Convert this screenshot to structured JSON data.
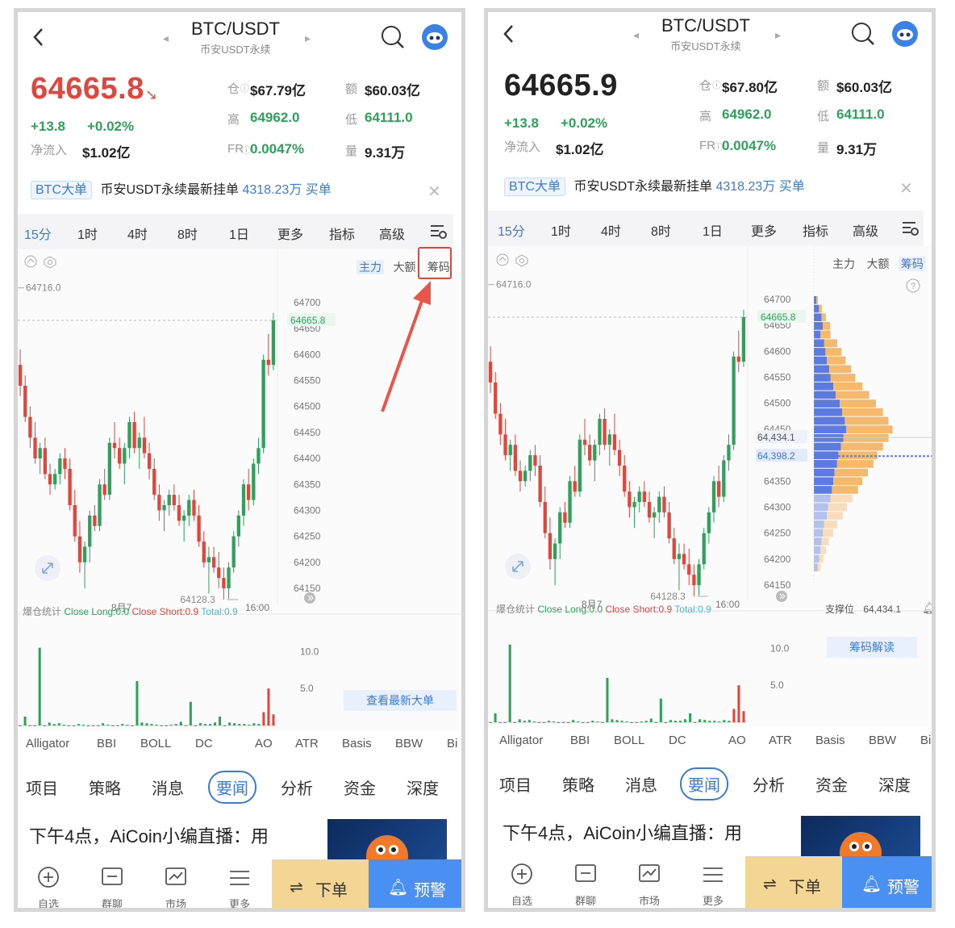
{
  "header": {
    "pair": "BTC/USDT",
    "subtitle": "币安USDT永续",
    "icons": [
      "back-arrow-icon",
      "prev-icon",
      "next-icon",
      "search-icon",
      "robot-avatar-icon"
    ]
  },
  "price_panel": {
    "left_price": "64665.8",
    "right_price": "64665.9",
    "change": "+13.8",
    "change_pct": "+0.02%",
    "net_inflow_label": "净流入",
    "net_inflow": "$1.02亿",
    "oi_label": "仓",
    "left_oi": "$67.79亿",
    "right_oi": "$67.80亿",
    "vol_label": "额",
    "vol": "$60.03亿",
    "high_label": "高",
    "high": "64962.0",
    "low_label": "低",
    "low": "64111.0",
    "fr_label": "FR",
    "fr": "0.0047%",
    "amount_label": "量",
    "amount": "9.31万"
  },
  "banner": {
    "tag": "BTC大单",
    "text": "币安USDT永续最新挂单",
    "amount": "4318.23万",
    "side": "买单"
  },
  "timeframes": {
    "items": [
      "15分",
      "1时",
      "4时",
      "8时",
      "1日",
      "更多",
      "指标",
      "高级"
    ],
    "active": "15分"
  },
  "chart": {
    "mode_buttons": [
      "主力",
      "大额",
      "筹码"
    ],
    "max_label": "64716.0",
    "min_label": "64128.3",
    "last_label": "64665.8",
    "y_ticks": [
      "64700",
      "64650",
      "64600",
      "64550",
      "64500",
      "64450",
      "64400",
      "64350",
      "64300",
      "64250",
      "64200",
      "64150"
    ],
    "x_ticks": [
      "8月7",
      "16:00"
    ],
    "support_levels": [
      "64,434.1",
      "64,398.2"
    ],
    "candles": [
      [
        64580,
        64610,
        64520,
        64540
      ],
      [
        64540,
        64560,
        64470,
        64480
      ],
      [
        64480,
        64500,
        64420,
        64440
      ],
      [
        64440,
        64470,
        64390,
        64400
      ],
      [
        64400,
        64430,
        64370,
        64420
      ],
      [
        64420,
        64440,
        64360,
        64370
      ],
      [
        64370,
        64390,
        64330,
        64350
      ],
      [
        64350,
        64380,
        64340,
        64370
      ],
      [
        64370,
        64410,
        64350,
        64400
      ],
      [
        64400,
        64420,
        64360,
        64380
      ],
      [
        64380,
        64400,
        64300,
        64310
      ],
      [
        64310,
        64340,
        64240,
        64250
      ],
      [
        64250,
        64280,
        64180,
        64200
      ],
      [
        64200,
        64240,
        64150,
        64230
      ],
      [
        64230,
        64300,
        64200,
        64290
      ],
      [
        64290,
        64310,
        64260,
        64270
      ],
      [
        64270,
        64360,
        64260,
        64350
      ],
      [
        64350,
        64380,
        64320,
        64330
      ],
      [
        64330,
        64440,
        64320,
        64430
      ],
      [
        64430,
        64470,
        64400,
        64420
      ],
      [
        64420,
        64440,
        64380,
        64390
      ],
      [
        64390,
        64430,
        64350,
        64420
      ],
      [
        64420,
        64480,
        64400,
        64470
      ],
      [
        64470,
        64490,
        64410,
        64420
      ],
      [
        64420,
        64450,
        64380,
        64440
      ],
      [
        64440,
        64480,
        64400,
        64410
      ],
      [
        64410,
        64430,
        64360,
        64380
      ],
      [
        64380,
        64400,
        64320,
        64330
      ],
      [
        64330,
        64350,
        64280,
        64300
      ],
      [
        64300,
        64320,
        64260,
        64310
      ],
      [
        64310,
        64340,
        64290,
        64330
      ],
      [
        64330,
        64350,
        64300,
        64310
      ],
      [
        64310,
        64330,
        64270,
        64280
      ],
      [
        64280,
        64300,
        64240,
        64290
      ],
      [
        64290,
        64330,
        64270,
        64320
      ],
      [
        64320,
        64340,
        64280,
        64290
      ],
      [
        64290,
        64310,
        64230,
        64240
      ],
      [
        64240,
        64260,
        64190,
        64200
      ],
      [
        64200,
        64230,
        64140,
        64210
      ],
      [
        64210,
        64230,
        64180,
        64190
      ],
      [
        64190,
        64220,
        64150,
        64170
      ],
      [
        64170,
        64190,
        64128.3,
        64150
      ],
      [
        64150,
        64200,
        64130,
        64190
      ],
      [
        64190,
        64260,
        64180,
        64250
      ],
      [
        64250,
        64300,
        64230,
        64290
      ],
      [
        64290,
        64360,
        64270,
        64350
      ],
      [
        64350,
        64380,
        64300,
        64320
      ],
      [
        64320,
        64400,
        64310,
        64390
      ],
      [
        64390,
        64440,
        64370,
        64420
      ],
      [
        64420,
        64600,
        64410,
        64590
      ],
      [
        64590,
        64640,
        64560,
        64580
      ],
      [
        64580,
        64680,
        64570,
        64665.8
      ]
    ],
    "profile_buy": [
      4,
      8,
      12,
      14,
      10,
      16,
      18,
      20,
      24,
      26,
      30,
      34,
      40,
      44,
      48,
      50,
      46,
      42,
      38,
      36,
      32,
      30,
      28,
      26,
      22,
      20,
      16,
      14,
      12,
      10,
      8,
      6
    ],
    "profile_sell": [
      2,
      4,
      6,
      10,
      14,
      18,
      22,
      26,
      30,
      34,
      40,
      46,
      50,
      56,
      60,
      64,
      62,
      58,
      54,
      50,
      46,
      40,
      36,
      30,
      26,
      22,
      18,
      14,
      10,
      8,
      6,
      4
    ]
  },
  "liquidation": {
    "label": "爆仓统计",
    "close_long": "Close Long:0.0",
    "close_short": "Close Short:0.9",
    "total": "Total:0.9",
    "ticks": [
      "10.0",
      "5.0"
    ],
    "bars": [
      0,
      1.2,
      0,
      0,
      10.5,
      0,
      0.4,
      0.2,
      0.3,
      0.1,
      0,
      0,
      0.2,
      0.1,
      0,
      0,
      0,
      0.3,
      0.1,
      0,
      0,
      0.2,
      0.1,
      0,
      6,
      0.4,
      0.3,
      0.2,
      0.1,
      0,
      0,
      0.1,
      0.2,
      0.5,
      0,
      3.2,
      0,
      0.3,
      0.2,
      0.2,
      0.4,
      1.2,
      0,
      0.4,
      0.3,
      0.2,
      0.2,
      0.1,
      0.3,
      0.2,
      1.8,
      5,
      1.5
    ],
    "bar_colors": [
      "#2ea15b",
      "#2ea15b",
      "#2ea15b",
      "#2ea15b",
      "#2ea15b",
      "#2ea15b",
      "#2ea15b",
      "#2ea15b",
      "#2ea15b",
      "#2ea15b",
      "#2ea15b",
      "#2ea15b",
      "#2ea15b",
      "#2ea15b",
      "#2ea15b",
      "#2ea15b",
      "#2ea15b",
      "#2ea15b",
      "#2ea15b",
      "#2ea15b",
      "#2ea15b",
      "#2ea15b",
      "#2ea15b",
      "#2ea15b",
      "#2ea15b",
      "#2ea15b",
      "#2ea15b",
      "#2ea15b",
      "#2ea15b",
      "#2ea15b",
      "#2ea15b",
      "#2ea15b",
      "#2ea15b",
      "#2ea15b",
      "#2ea15b",
      "#2ea15b",
      "#2ea15b",
      "#2ea15b",
      "#2ea15b",
      "#2ea15b",
      "#2ea15b",
      "#2ea15b",
      "#2ea15b",
      "#2ea15b",
      "#2ea15b",
      "#2ea15b",
      "#2ea15b",
      "#2ea15b",
      "#2ea15b",
      "#2ea15b",
      "#e0463c",
      "#e0463c",
      "#e0463c"
    ],
    "view_big_orders": "查看最新大单",
    "support_label": "支撑位",
    "support_value": "64,434.1",
    "chip_explain": "筹码解读"
  },
  "indicators": [
    "Alligator",
    "BBI",
    "BOLL",
    "DC",
    "AO",
    "ATR",
    "Basis",
    "BBW",
    "Bi"
  ],
  "news_tabs": {
    "items": [
      "项目",
      "策略",
      "消息",
      "要闻",
      "分析",
      "资金",
      "深度"
    ],
    "active": "要闻"
  },
  "news": {
    "headline": "下午4点，AiCoin小编直播：用"
  },
  "bottom_nav": {
    "items": [
      "自选",
      "群聊",
      "市场",
      "更多"
    ],
    "order": "下单",
    "alert": "预警"
  },
  "colors": {
    "accent": "#3a7bd5",
    "up": "#2ea15b",
    "down": "#e0463c",
    "sell_profile": "#f6b86a",
    "buy_profile": "#5b7be0"
  }
}
